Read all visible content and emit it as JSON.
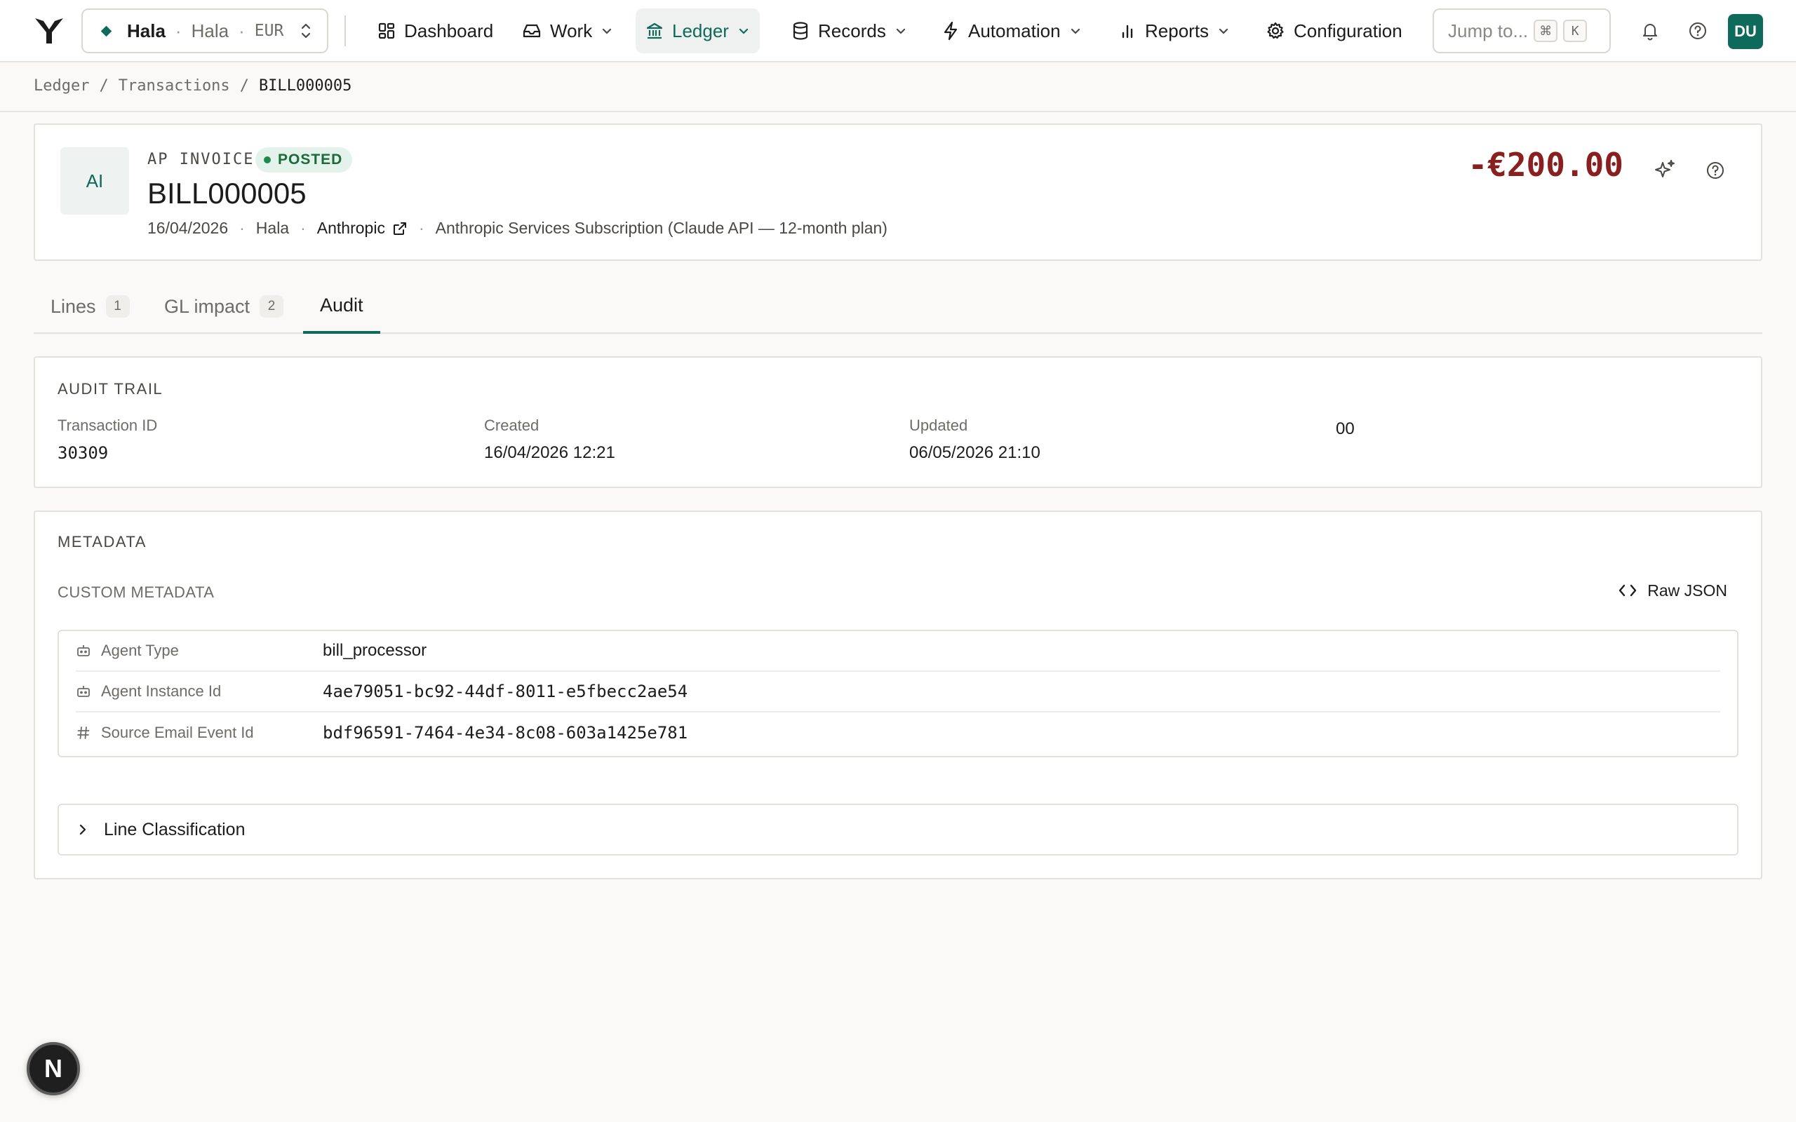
{
  "nav": {
    "entity": {
      "name": "Hala",
      "subsidiary": "Hala",
      "currency": "EUR"
    },
    "items": [
      {
        "label": "Dashboard",
        "icon": "grid-icon"
      },
      {
        "label": "Work",
        "icon": "inbox-icon"
      },
      {
        "label": "Ledger",
        "icon": "bank-icon"
      },
      {
        "label": "Records",
        "icon": "database-icon"
      },
      {
        "label": "Automation",
        "icon": "bolt-icon"
      },
      {
        "label": "Reports",
        "icon": "bar-chart-icon"
      },
      {
        "label": "Configuration",
        "icon": "gear-icon"
      }
    ],
    "active_item": "Ledger",
    "jump_placeholder": "Jump to...",
    "jump_shortcut": [
      "⌘",
      "K"
    ],
    "avatar_initials": "DU"
  },
  "breadcrumb": [
    "Ledger",
    "Transactions",
    "BILL000005"
  ],
  "transaction": {
    "badge_initials": "AI",
    "doc_type": "AP INVOICE",
    "status": "POSTED",
    "number": "BILL000005",
    "date": "16/04/2026",
    "entity": "Hala",
    "vendor": "Anthropic",
    "memo": "Anthropic Services Subscription (Claude API — 12-month plan)",
    "amount": "-€200.00"
  },
  "tabs": [
    {
      "label": "Lines",
      "count": "1"
    },
    {
      "label": "GL impact",
      "count": "2"
    },
    {
      "label": "Audit",
      "count": null
    }
  ],
  "active_tab": "Audit",
  "audit": {
    "title": "AUDIT TRAIL",
    "fields": [
      {
        "label": "Transaction ID",
        "value": "30309"
      },
      {
        "label": "Created",
        "value": "16/04/2026 12:21"
      },
      {
        "label": "Updated",
        "value": "06/05/2026 21:10"
      }
    ],
    "extra_value": "00"
  },
  "metadata": {
    "title": "METADATA",
    "custom_title": "CUSTOM METADATA",
    "raw_json_label": "Raw JSON",
    "rows": [
      {
        "icon": "bot-icon",
        "key": "Agent Type",
        "value": "bill_processor"
      },
      {
        "icon": "bot-icon",
        "key": "Agent Instance Id",
        "value": "4ae79051-bc92-44df-8011-e5fbecc2ae54"
      },
      {
        "icon": "hash-icon",
        "key": "Source Email Event Id",
        "value": "bdf96591-7464-4e34-8c08-603a1425e781"
      }
    ],
    "accordion_label": "Line Classification"
  },
  "floating_badge": "N",
  "colors": {
    "accent": "#0e6b5b",
    "negative_amount": "#8a1f1f",
    "posted": "#1b6b3a"
  }
}
